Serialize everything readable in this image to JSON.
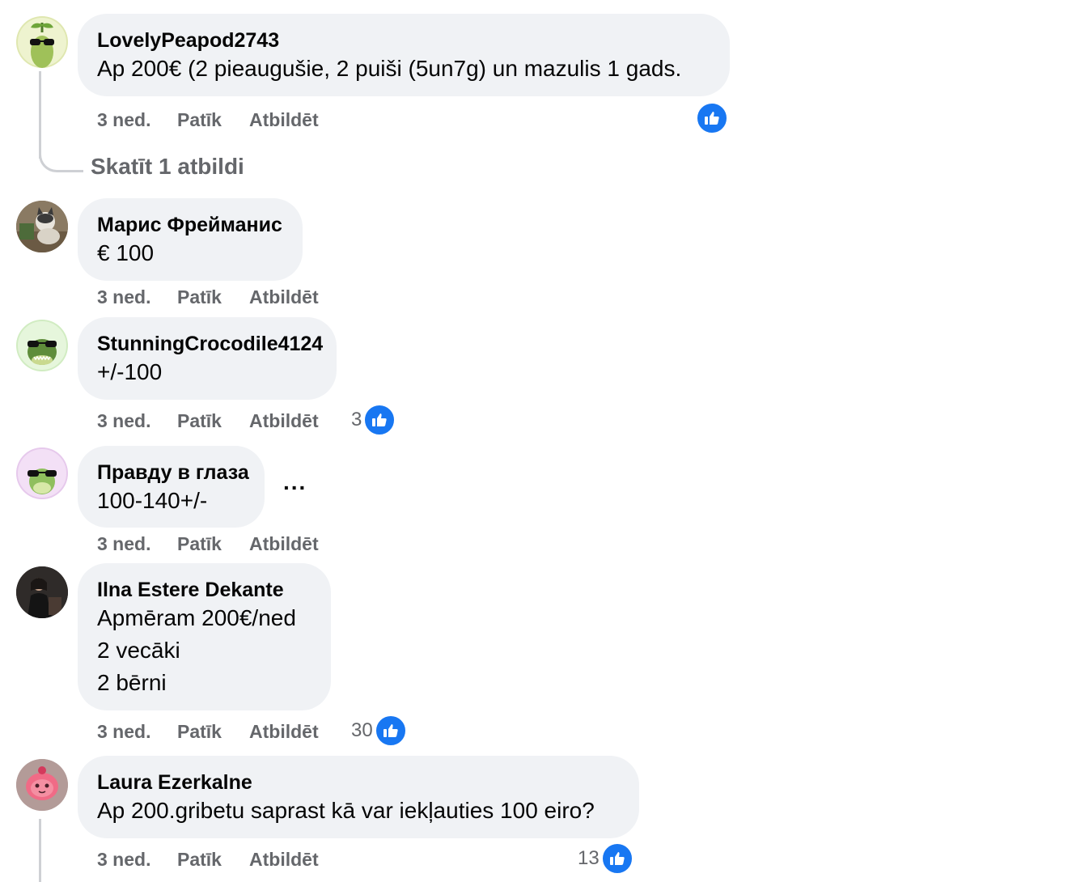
{
  "comments": [
    {
      "author": "LovelyPeapod2743",
      "lines": [
        "Ap 200€ (2 pieaugušie, 2 puiši (5un7g) un mazulis 1 gads."
      ],
      "time": "3 ned.",
      "like_label": "Patīk",
      "reply_label": "Atbildēt",
      "reaction_count": "",
      "avatar_icon": "pea-sunglasses-avatar-icon"
    },
    {
      "author": "Марис Фрейманис",
      "lines": [
        "€ 100"
      ],
      "time": "3 ned.",
      "like_label": "Patīk",
      "reply_label": "Atbildēt",
      "reaction_count": "",
      "avatar_icon": "photo-avatar-icon"
    },
    {
      "author": "StunningCrocodile4124",
      "lines": [
        "+/-100"
      ],
      "time": "3 ned.",
      "like_label": "Patīk",
      "reply_label": "Atbildēt",
      "reaction_count": "3",
      "avatar_icon": "crocodile-sunglasses-avatar-icon"
    },
    {
      "author": "Правду в глаза",
      "lines": [
        "100-140+/-"
      ],
      "time": "3 ned.",
      "like_label": "Patīk",
      "reply_label": "Atbildēt",
      "reaction_count": "",
      "more_label": "...",
      "avatar_icon": "frog-sunglasses-avatar-icon"
    },
    {
      "author": "Ilna Estere Dekante",
      "lines": [
        "Apmēram 200€/ned",
        "2 vecāki",
        "2 bērni"
      ],
      "time": "3 ned.",
      "like_label": "Patīk",
      "reply_label": "Atbildēt",
      "reaction_count": "30",
      "avatar_icon": "photo-avatar-icon"
    },
    {
      "author": "Laura Ezerkalne",
      "lines": [
        "Ap 200.gribetu saprast kā var iekļauties 100 eiro?"
      ],
      "time": "3 ned.",
      "like_label": "Patīk",
      "reply_label": "Atbildēt",
      "reaction_count": "13",
      "avatar_icon": "pink-character-avatar-icon"
    }
  ],
  "view_replies_label": "Skatīt 1 atbildi",
  "colors": {
    "bubble_bg": "#f0f2f5",
    "like_blue": "#1877f2",
    "secondary_text": "#65676b",
    "thread_line": "#ced0d4"
  }
}
